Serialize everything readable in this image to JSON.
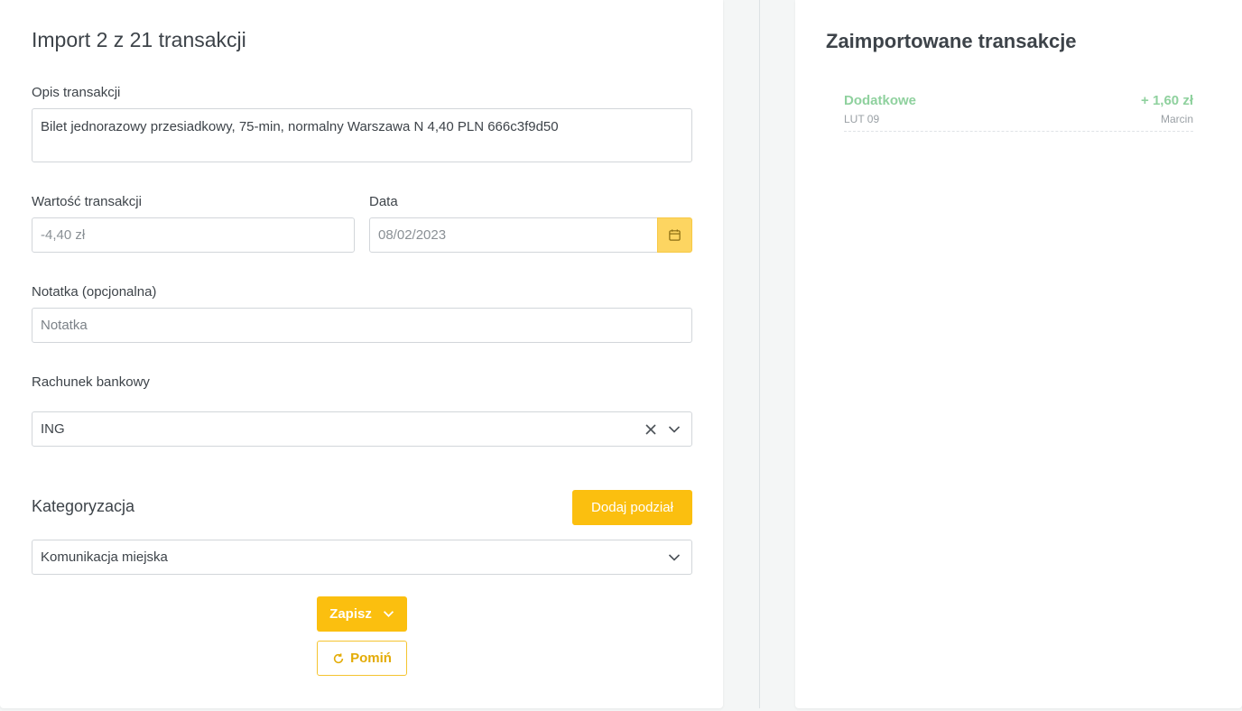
{
  "import_form": {
    "title": "Import 2 z 21 transakcji",
    "description_label": "Opis transakcji",
    "description_value": "Bilet jednorazowy przesiadkowy, 75-min, normalny Warszawa N 4,40 PLN 666c3f9d50",
    "amount_label": "Wartość transakcji",
    "amount_value": "-4,40 zł",
    "date_label": "Data",
    "date_value": "08/02/2023",
    "note_label": "Notatka (opcjonalna)",
    "note_placeholder": "Notatka",
    "bank_account_label": "Rachunek bankowy",
    "bank_account_value": "ING",
    "categorization_title": "Kategoryzacja",
    "add_split_label": "Dodaj podział",
    "category_value": "Komunikacja miejska",
    "save_label": "Zapisz",
    "skip_label": "Pomiń"
  },
  "imported": {
    "title": "Zaimportowane transakcje",
    "items": [
      {
        "category": "Dodatkowe",
        "amount": "+ 1,60 zł",
        "date": "LUT 09",
        "user": "Marcin"
      }
    ]
  },
  "colors": {
    "accent": "#fbbf0f",
    "accent_light": "#fdd561",
    "income": "#8fd19e"
  },
  "icons": {
    "date": "calendar-icon",
    "clear": "close-icon",
    "dropdown": "chevron-down-icon",
    "skip": "refresh-icon"
  }
}
